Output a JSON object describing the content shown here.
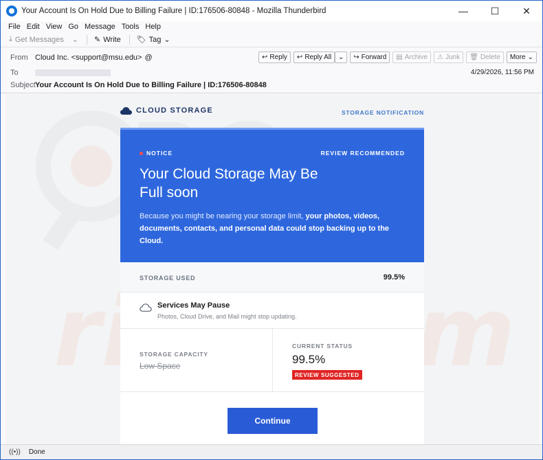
{
  "window": {
    "title": "Your Account Is On Hold Due to Billing Failure | ID:176506-80848 - Mozilla Thunderbird",
    "controls": [
      "—",
      "☐",
      "✕"
    ]
  },
  "menu": [
    "File",
    "Edit",
    "View",
    "Go",
    "Message",
    "Tools",
    "Help"
  ],
  "toolbar": {
    "get_messages": "Get Messages",
    "write": "Write",
    "tag": "Tag"
  },
  "header": {
    "from_label": "From",
    "from_value": "Cloud Inc. <support@msu.edu>",
    "to_label": "To",
    "subject_label": "Subject",
    "subject_value": "Your Account Is On Hold Due to Billing Failure | ID:176506-80848",
    "date": "4/29/2026, 11:56 PM",
    "actions": {
      "reply": "Reply",
      "reply_all": "Reply All",
      "forward": "Forward",
      "archive": "Archive",
      "junk": "Junk",
      "delete": "Delete",
      "more": "More"
    }
  },
  "email": {
    "brand": "CLOUD STORAGE",
    "notification_link": "STORAGE NOTIFICATION",
    "notice": "NOTICE",
    "review_recommended": "REVIEW RECOMMENDED",
    "hero_title": "Your Cloud Storage May Be Full soon",
    "hero_text_plain": "Because you might be nearing your storage limit, ",
    "hero_text_bold": "your photos, videos, documents, contacts, and personal data could stop backing up to the Cloud.",
    "storage_used_label": "STORAGE USED",
    "storage_used_value": "99.5%",
    "pause_title": "Services May Pause",
    "pause_subtitle": "Photos, Cloud Drive, and Mail might stop updating.",
    "capacity_label": "STORAGE CAPACITY",
    "capacity_value": "Low Space",
    "current_status_label": "CURRENT STATUS",
    "current_status_value": "99.5%",
    "status_badge": "REVIEW SUGGESTED",
    "continue_label": "Continue"
  },
  "statusbar": {
    "text": "Done"
  },
  "colors": {
    "hero_blue": "#2e67dd",
    "button_blue": "#2a5bd7",
    "badge_red": "#e02424",
    "brand_navy": "#1d3566"
  }
}
